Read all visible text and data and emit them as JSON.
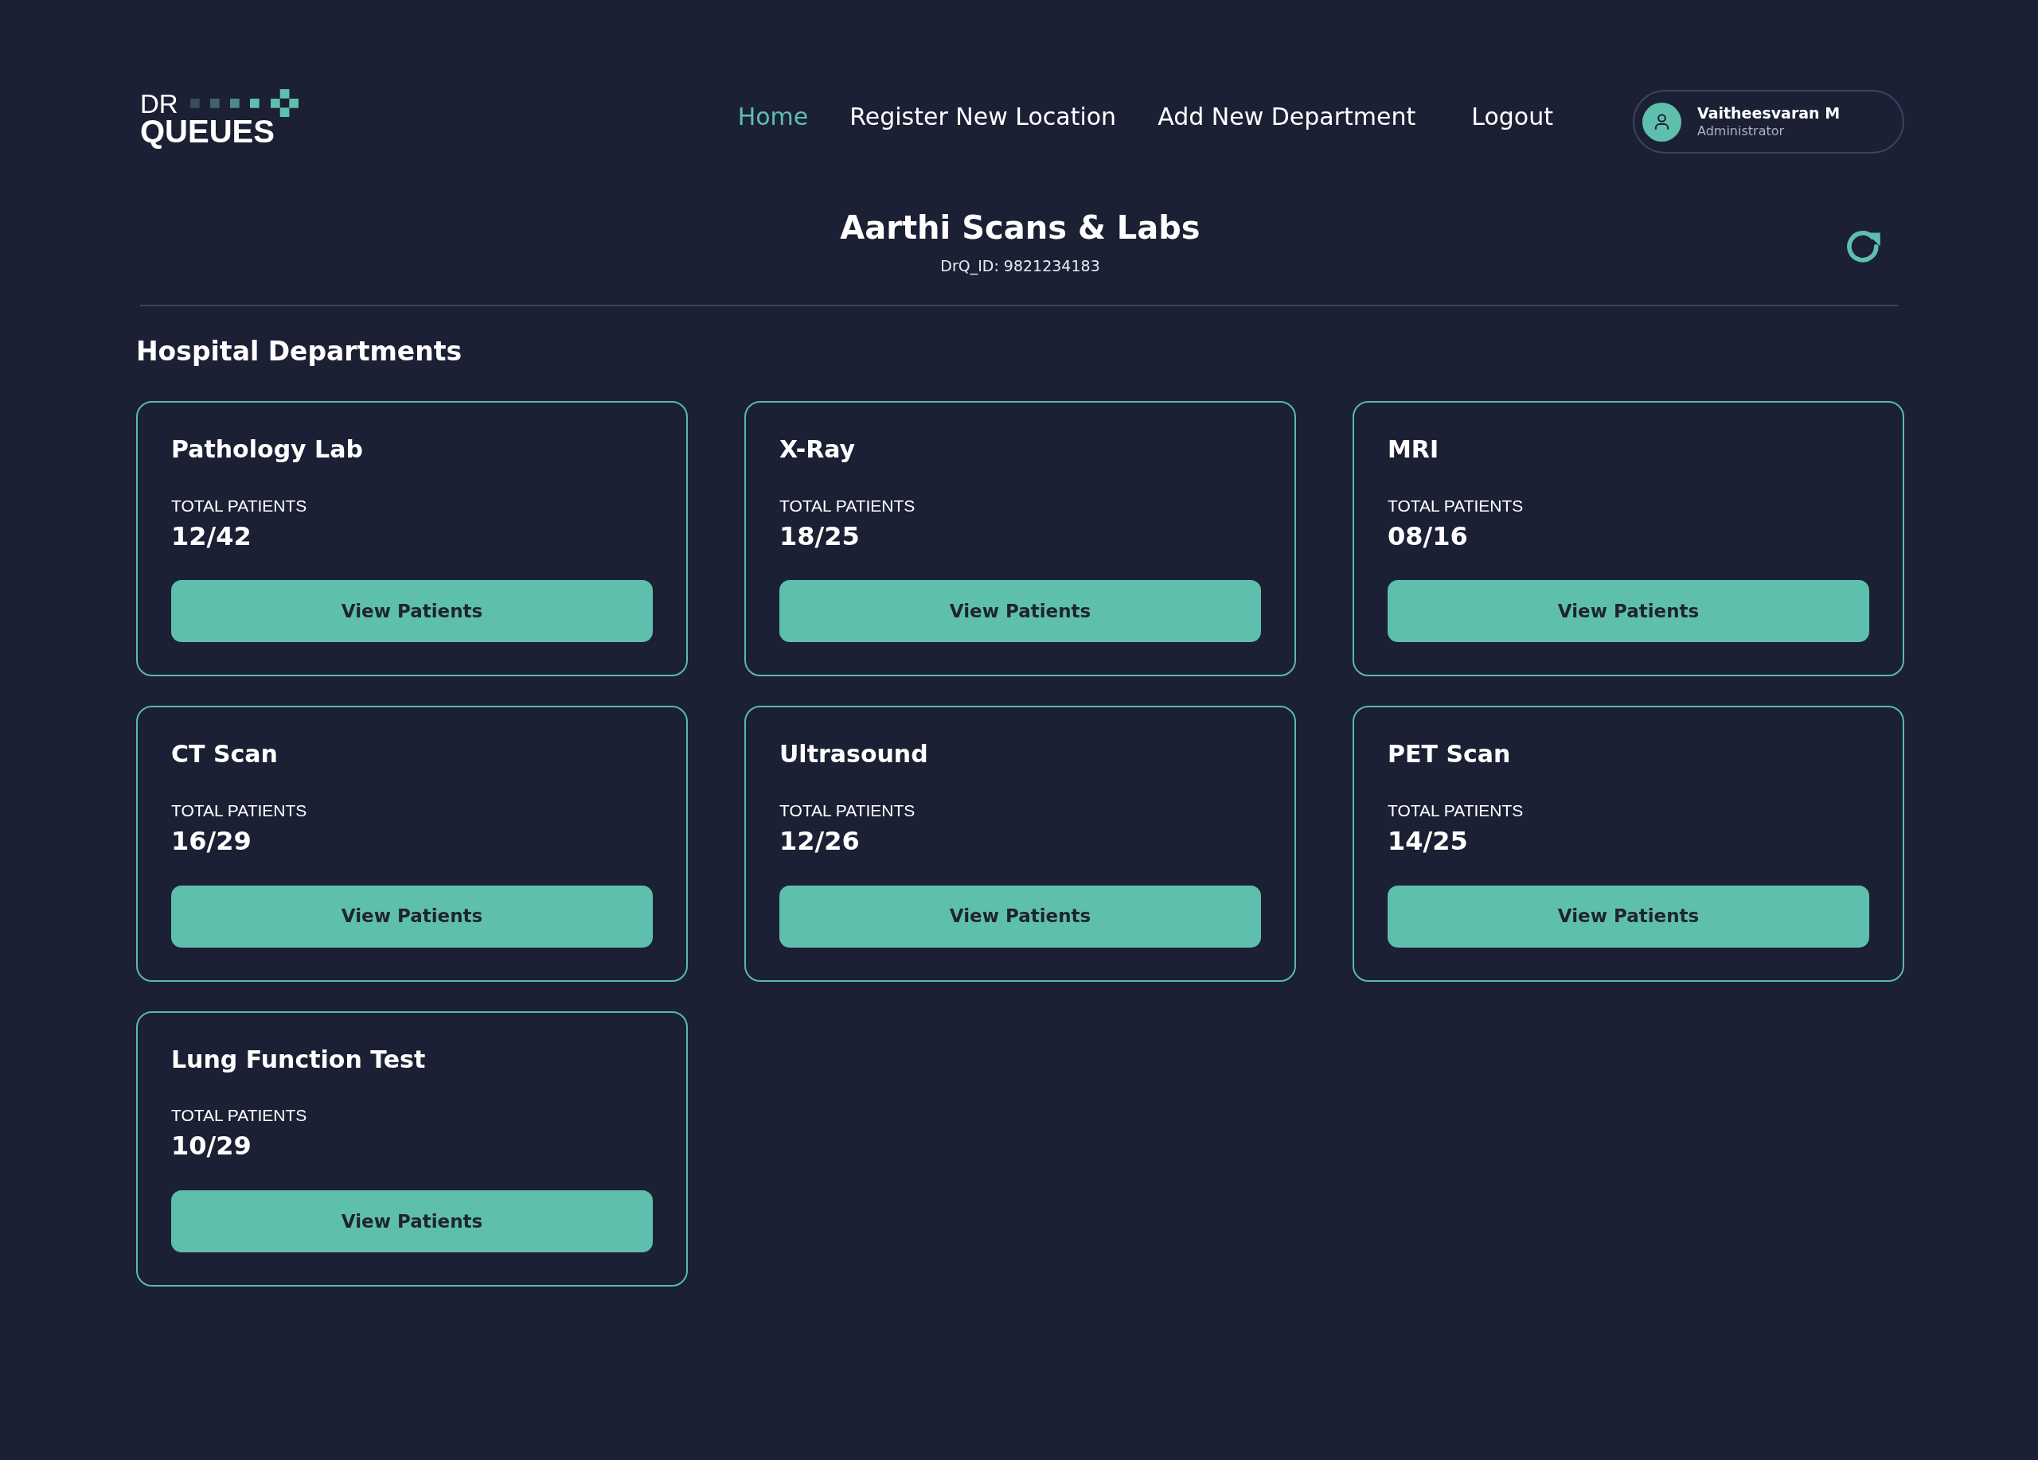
{
  "logo": {
    "line_1": "DR",
    "line_2": "QUEUES"
  },
  "nav": [
    {
      "label": "Home",
      "selected": true
    },
    {
      "label": "Register New Location",
      "selected": false
    },
    {
      "label": "Add New Department",
      "selected": false
    },
    {
      "label": "Logout",
      "selected": false
    }
  ],
  "user": {
    "name": "Vaitheesvaran M",
    "role": "Administrator"
  },
  "header": {
    "title": "Aarthi Scans & Labs",
    "id_text": "DrQ_ID: 9821234183"
  },
  "section_title": "Hospital Departments",
  "departments": [
    {
      "name": "Pathology Lab",
      "stat_label": "TOTAL PATIENTS",
      "stat_value": "12/42",
      "button": "View Patients"
    },
    {
      "name": "X-Ray",
      "stat_label": "TOTAL PATIENTS",
      "stat_value": "18/25",
      "button": "View Patients"
    },
    {
      "name": "MRI",
      "stat_label": "TOTAL PATIENTS",
      "stat_value": "08/16",
      "button": "View Patients"
    },
    {
      "name": "CT Scan",
      "stat_label": "TOTAL PATIENTS",
      "stat_value": "16/29",
      "button": "View Patients"
    },
    {
      "name": "Ultrasound",
      "stat_label": "TOTAL PATIENTS",
      "stat_value": "12/26",
      "button": "View Patients"
    },
    {
      "name": "PET Scan",
      "stat_label": "TOTAL PATIENTS",
      "stat_value": "14/25",
      "button": "View Patients"
    },
    {
      "name": "Lung Function Test",
      "stat_label": "TOTAL PATIENTS",
      "stat_value": "10/29",
      "button": "View Patients"
    }
  ]
}
